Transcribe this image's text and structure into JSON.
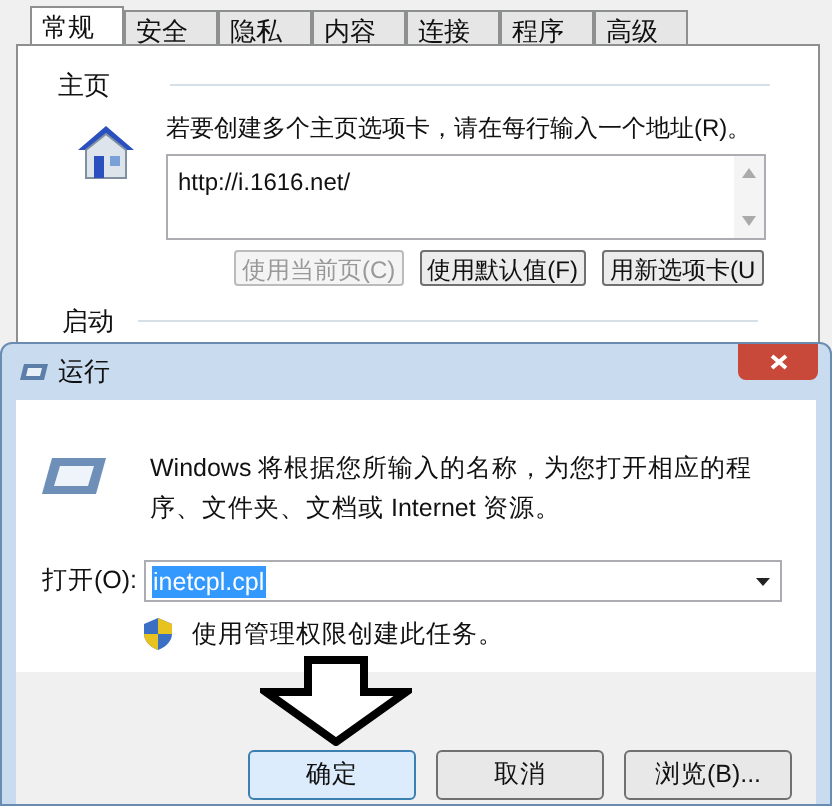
{
  "options_window": {
    "tabs": [
      {
        "label": "常规",
        "selected": true
      },
      {
        "label": "安全",
        "selected": false
      },
      {
        "label": "隐私",
        "selected": false
      },
      {
        "label": "内容",
        "selected": false
      },
      {
        "label": "连接",
        "selected": false
      },
      {
        "label": "程序",
        "selected": false
      },
      {
        "label": "高级",
        "selected": false
      }
    ],
    "home_section": {
      "title": "主页",
      "instruction": "若要创建多个主页选项卡，请在每行输入一个地址(R)。",
      "urls": "http://i.1616.net/",
      "buttons": [
        {
          "label": "使用当前页(C)",
          "disabled": true
        },
        {
          "label": "使用默认值(F)",
          "disabled": false
        },
        {
          "label": "用新选项卡(U",
          "disabled": false
        }
      ]
    },
    "startup_section": {
      "title": "启动"
    }
  },
  "run_dialog": {
    "title": "运行",
    "description": "Windows 将根据您所输入的名称，为您打开相应的程序、文件夹、文档或 Internet 资源。",
    "open_label": "打开(O):",
    "open_value": "inetcpl.cpl",
    "admin_note": "使用管理权限创建此任务。",
    "buttons": [
      {
        "label": "确定",
        "selected": true
      },
      {
        "label": "取消",
        "selected": false
      },
      {
        "label": "浏览(B)...",
        "selected": false
      }
    ]
  }
}
